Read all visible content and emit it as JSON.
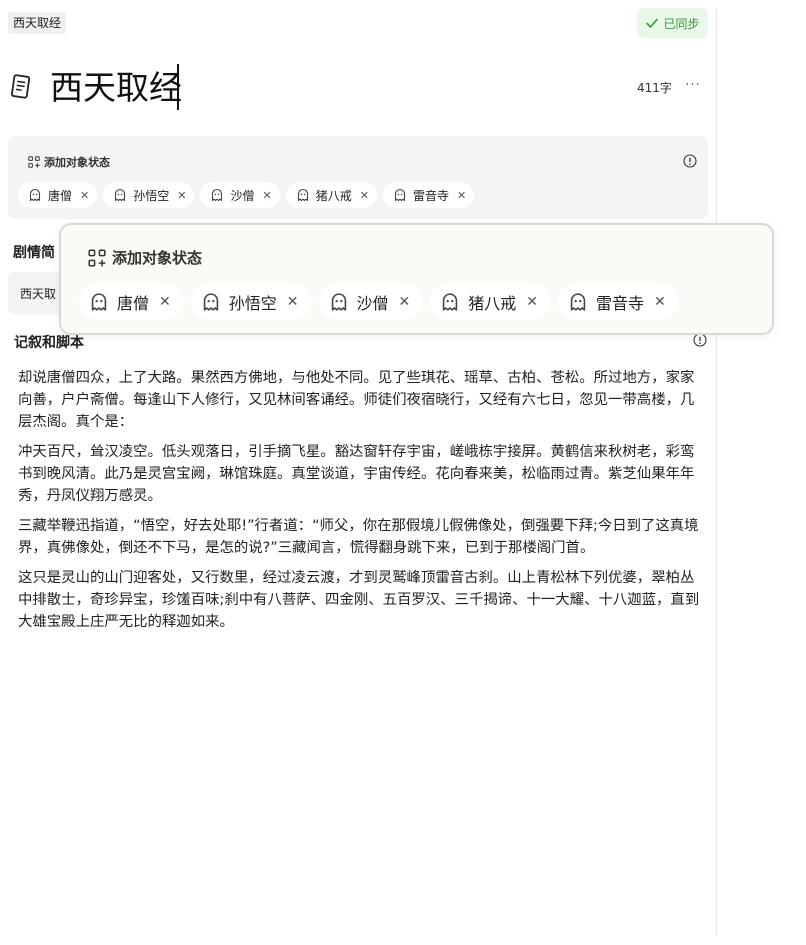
{
  "breadcrumb": "西天取经",
  "sync_status": "已同步",
  "document": {
    "title": "西天取经",
    "word_count": "411字",
    "more_label": "···"
  },
  "status_panel": {
    "title": "添加对象状态",
    "chips": [
      {
        "label": "唐僧"
      },
      {
        "label": "孙悟空"
      },
      {
        "label": "沙僧"
      },
      {
        "label": "猪八戒"
      },
      {
        "label": "雷音寺"
      }
    ]
  },
  "plot_section": {
    "label": "剧情简",
    "value": "西天取"
  },
  "popover": {
    "title": "添加对象状态",
    "chips": [
      {
        "label": "唐僧"
      },
      {
        "label": "孙悟空"
      },
      {
        "label": "沙僧"
      },
      {
        "label": "猪八戒"
      },
      {
        "label": "雷音寺"
      }
    ]
  },
  "narrative": {
    "title": "记叙和脚本",
    "paragraphs": [
      "却说唐僧四众，上了大路。果然西方佛地，与他处不同。见了些琪花、瑶草、古柏、苍松。所过地方，家家向善，户户斋僧。每逢山下人修行，又见林间客诵经。师徒们夜宿晓行，又经有六七日，忽见一带高楼，几层杰阁。真个是：",
      "冲天百尺，耸汉凌空。低头观落日，引手摘飞星。豁达窗轩存宇宙，嵯峨栋宇接屏。黄鹤信来秋树老，彩鸾书到晚风清。此乃是灵宫宝阙，琳馆珠庭。真堂谈道，宇宙传经。花向春来美，松临雨过青。紫芝仙果年年秀，丹凤仪翔万感灵。",
      "三藏举鞭迅指道，“悟空，好去处耶!”行者道：“师父，你在那假境儿假佛像处，倒强要下拜;今日到了这真境界，真佛像处，倒还不下马，是怎的说?”三藏闻言，慌得翻身跳下来，已到于那楼阁门首。",
      "这只是灵山的山门迎客处，又行数里，经过凌云渡，才到灵鹫峰顶雷音古刹。山上青松林下列优婆，翠柏丛中排散士，奇珍异宝，珍馐百味;刹中有八菩萨、四金刚、五百罗汉、三千揭谛、十一大耀、十八迦蓝，直到大雄宝殿上庄严无比的释迦如来。"
    ]
  },
  "icons": {
    "doc": "document-icon",
    "sync": "check-icon",
    "status": "status-grid-icon",
    "chip": "ghost-icon",
    "remove": "close-icon",
    "info": "info-icon"
  },
  "colors": {
    "sync_bg": "#eaf8ea",
    "sync_text": "#2e9d3a",
    "card_bg": "#f4f4f4",
    "popover_border": "#d8d8cc"
  }
}
